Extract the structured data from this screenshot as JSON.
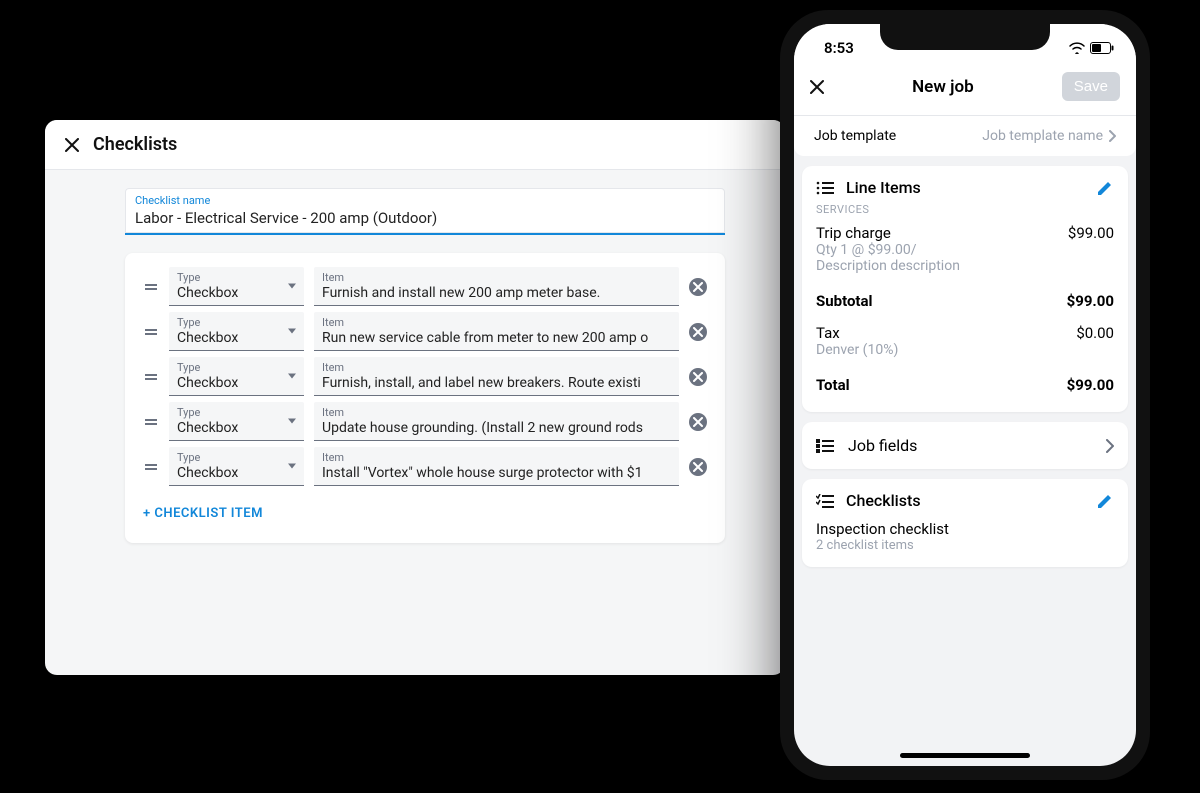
{
  "desktop": {
    "title": "Checklists",
    "name_label": "Checklist name",
    "name_value": "Labor - Electrical Service - 200 amp (Outdoor)",
    "type_label": "Type",
    "item_label": "Item",
    "items": [
      {
        "type": "Checkbox",
        "text": "Furnish and install new 200 amp meter base."
      },
      {
        "type": "Checkbox",
        "text": "Run new service cable from meter to new 200 amp o"
      },
      {
        "type": "Checkbox",
        "text": "Furnish, install, and label new breakers. Route existi"
      },
      {
        "type": "Checkbox",
        "text": "Update house grounding. (Install 2 new ground rods"
      },
      {
        "type": "Checkbox",
        "text": "Install \"Vortex\" whole house surge protector with $1"
      }
    ],
    "add_label": "+ CHECKLIST ITEM"
  },
  "phone": {
    "time": "8:53",
    "header_title": "New job",
    "save_label": "Save",
    "template_label": "Job template",
    "template_value": "Job template name",
    "line_items_title": "Line Items",
    "services_label": "SERVICES",
    "service_name": "Trip charge",
    "service_price": "$99.00",
    "service_qty": "Qty 1 @ $99.00/",
    "service_desc": "Description description",
    "subtotal_label": "Subtotal",
    "subtotal_value": "$99.00",
    "tax_label": "Tax",
    "tax_detail": "Denver (10%)",
    "tax_value": "$0.00",
    "total_label": "Total",
    "total_value": "$99.00",
    "job_fields_label": "Job fields",
    "checklists_label": "Checklists",
    "checklist_item_name": "Inspection checklist",
    "checklist_item_count": "2 checklist items"
  }
}
